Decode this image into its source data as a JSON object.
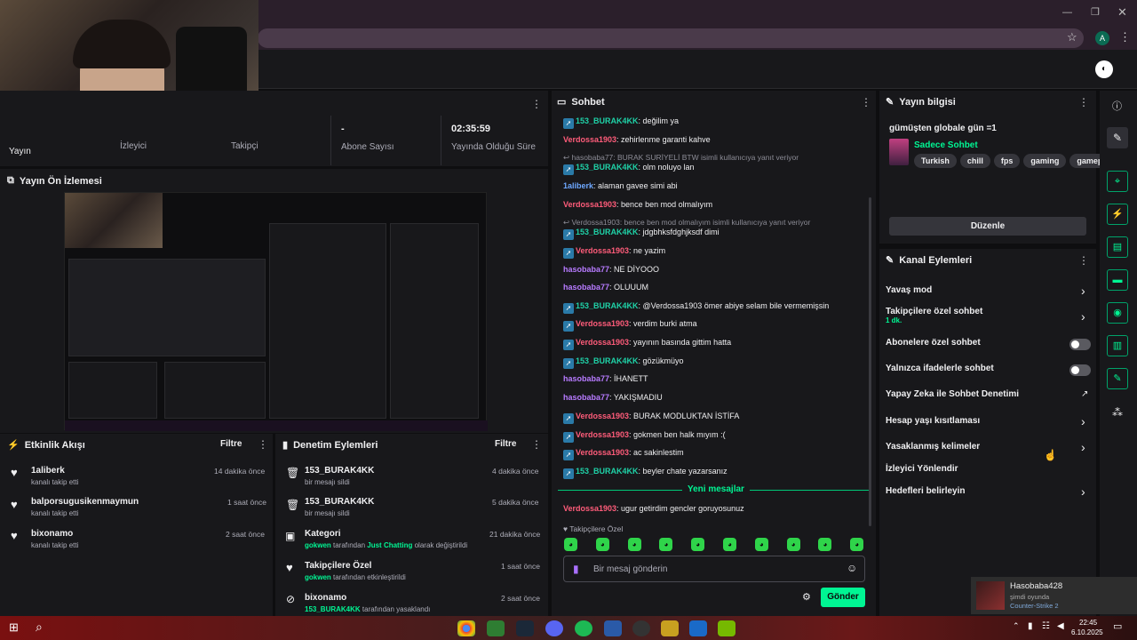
{
  "browser": {
    "profile_initial": "A"
  },
  "stats": [
    {
      "value": "",
      "label": "Yayın"
    },
    {
      "value": "",
      "label": "İzleyici"
    },
    {
      "value": "",
      "label": "Takipçi"
    },
    {
      "value": "-",
      "label": "Abone Sayısı"
    },
    {
      "value": "02:35:59",
      "label": "Yayında Olduğu Süre"
    }
  ],
  "preview": {
    "title": "Yayın Ön İzlemesi"
  },
  "activity": {
    "title": "Etkinlik Akışı",
    "filter": "Filtre",
    "items": [
      {
        "user": "1aliberk",
        "sub": "kanalı takip etti",
        "time": "14 dakika önce"
      },
      {
        "user": "balporsugusikenmaymun",
        "sub": "kanalı takip etti",
        "time": "1 saat önce"
      },
      {
        "user": "bixonamo",
        "sub": "kanalı takip etti",
        "time": "2 saat önce"
      }
    ]
  },
  "moderation": {
    "title": "Denetim Eylemleri",
    "filter": "Filtre",
    "items": [
      {
        "title": "153_BURAK4KK",
        "pre": "",
        "hl1": "",
        "mid": "bir mesajı sildi",
        "hl2": "",
        "post": "",
        "time": "4 dakika önce"
      },
      {
        "title": "153_BURAK4KK",
        "pre": "",
        "hl1": "",
        "mid": "bir mesajı sildi",
        "hl2": "",
        "post": "",
        "time": "5 dakika önce"
      },
      {
        "title": "Kategori",
        "pre": "",
        "hl1": "gokwen",
        "mid": " tarafından ",
        "hl2": "Just Chatting",
        "post": " olarak değiştirildi",
        "time": "21 dakika önce"
      },
      {
        "title": "Takipçilere Özel",
        "pre": "",
        "hl1": "gokwen",
        "mid": " tarafından etkinleştirildi",
        "hl2": "",
        "post": "",
        "time": "1 saat önce"
      },
      {
        "title": "bixonamo",
        "pre": "",
        "hl1": "153_BURAK4KK",
        "mid": " tarafından yasaklandı",
        "hl2": "",
        "post": "",
        "time": "2 saat önce"
      }
    ]
  },
  "chat": {
    "title": "Sohbet",
    "messages": [
      {
        "kind": "msg",
        "badge": true,
        "user": "153_BURAK4KK",
        "color": "green",
        "text": ": değilim ya"
      },
      {
        "kind": "msg",
        "badge": false,
        "user": "Verdossa1903",
        "color": "red",
        "text": ": zehirlenme garanti kahve"
      },
      {
        "kind": "reply",
        "text": "hasobaba77: BURAK SURİYELİ BTW isimli kullanıcıya yanıt veriyor"
      },
      {
        "kind": "msg",
        "badge": true,
        "user": "153_BURAK4KK",
        "color": "green",
        "text": ": olm noluyo lan"
      },
      {
        "kind": "msg",
        "badge": false,
        "user": "1aliberk",
        "color": "blue",
        "text": ": alaman gavee simi abi"
      },
      {
        "kind": "msg",
        "badge": false,
        "user": "Verdossa1903",
        "color": "red",
        "text": ": bence ben mod olmalıyım"
      },
      {
        "kind": "reply",
        "text": "Verdossa1903: bence ben mod olmalıyım isimli kullanıcıya yanıt veriyor"
      },
      {
        "kind": "msg",
        "badge": true,
        "user": "153_BURAK4KK",
        "color": "green",
        "text": ": jdgbhksfdghjksdf dimi"
      },
      {
        "kind": "msg",
        "badge": true,
        "user": "Verdossa1903",
        "color": "red",
        "text": ": ne yazim"
      },
      {
        "kind": "msg",
        "badge": false,
        "user": "hasobaba77",
        "color": "purple",
        "text": ": NE DİYOOO"
      },
      {
        "kind": "msg",
        "badge": false,
        "user": "hasobaba77",
        "color": "purple",
        "text": ": OLUUUM"
      },
      {
        "kind": "msg",
        "badge": true,
        "user": "153_BURAK4KK",
        "color": "green",
        "text": ": @Verdossa1903 ömer abiye selam bile vermemişsin"
      },
      {
        "kind": "msg",
        "badge": true,
        "user": "Verdossa1903",
        "color": "red",
        "text": ": verdim burki atma"
      },
      {
        "kind": "msg",
        "badge": true,
        "user": "Verdossa1903",
        "color": "red",
        "text": ": yayının basında gittim hatta"
      },
      {
        "kind": "msg",
        "badge": true,
        "user": "153_BURAK4KK",
        "color": "green",
        "text": ": gözükmüyo"
      },
      {
        "kind": "msg",
        "badge": false,
        "user": "hasobaba77",
        "color": "purple",
        "text": ": İHANETT"
      },
      {
        "kind": "msg",
        "badge": false,
        "user": "hasobaba77",
        "color": "purple",
        "text": ": YAKIŞMADIU"
      },
      {
        "kind": "msg",
        "badge": true,
        "user": "Verdossa1903",
        "color": "red",
        "text": ": BURAK MODLUKTAN İSTİFA"
      },
      {
        "kind": "msg",
        "badge": true,
        "user": "Verdossa1903",
        "color": "red",
        "text": ": gokmen ben halk mıyım :("
      },
      {
        "kind": "msg",
        "badge": true,
        "user": "Verdossa1903",
        "color": "red",
        "text": ": ac sakinlestim"
      },
      {
        "kind": "msg",
        "badge": true,
        "user": "153_BURAK4KK",
        "color": "green",
        "text": ": beyler chate yazarsanız"
      }
    ],
    "new_messages": "Yeni mesajlar",
    "after": {
      "user": "Verdossa1903",
      "text": ": ugur getirdim gencler goruyosunuz"
    },
    "followers_only": "Takipçilere Özel",
    "placeholder": "Bir mesaj gönderin",
    "send": "Gönder"
  },
  "stream_info": {
    "title": "Yayın bilgisi",
    "stream_title": "gümüşten globale gün =1",
    "category": "Sadece Sohbet",
    "tags": [
      "Turkish",
      "chill",
      "fps",
      "gaming",
      "gameplay"
    ],
    "edit": "Düzenle"
  },
  "channel_actions": {
    "title": "Kanal Eylemleri",
    "items": [
      {
        "label": "Yavaş mod",
        "sub": "",
        "ctrl": "chevron"
      },
      {
        "label": "Takipçilere özel sohbet",
        "sub": "1 dk.",
        "ctrl": "chevron"
      },
      {
        "label": "Abonelere özel sohbet",
        "sub": "",
        "ctrl": "toggle"
      },
      {
        "label": "Yalnızca ifadelerle sohbet",
        "sub": "",
        "ctrl": "toggle"
      },
      {
        "label": "Yapay Zeka ile Sohbet Denetimi",
        "sub": "",
        "ctrl": "external"
      },
      {
        "label": "Hesap yaşı kısıtlaması",
        "sub": "",
        "ctrl": "chevron"
      },
      {
        "label": "Yasaklanmış kelimeler",
        "sub": "",
        "ctrl": "chevron"
      },
      {
        "label": "İzleyici Yönlendir",
        "sub": "",
        "ctrl": "none"
      },
      {
        "label": "Hedefleri belirleyin",
        "sub": "",
        "ctrl": "chevron"
      }
    ]
  },
  "toast": {
    "name": "Hasobaba428",
    "status": "şimdi oyunda",
    "game": "Counter-Strike 2"
  },
  "taskbar": {
    "time": "22:45",
    "date": "6.10.2025"
  },
  "colors": {
    "accent": "#00f593",
    "panel": "#18181b",
    "bg": "#0e0e10"
  }
}
